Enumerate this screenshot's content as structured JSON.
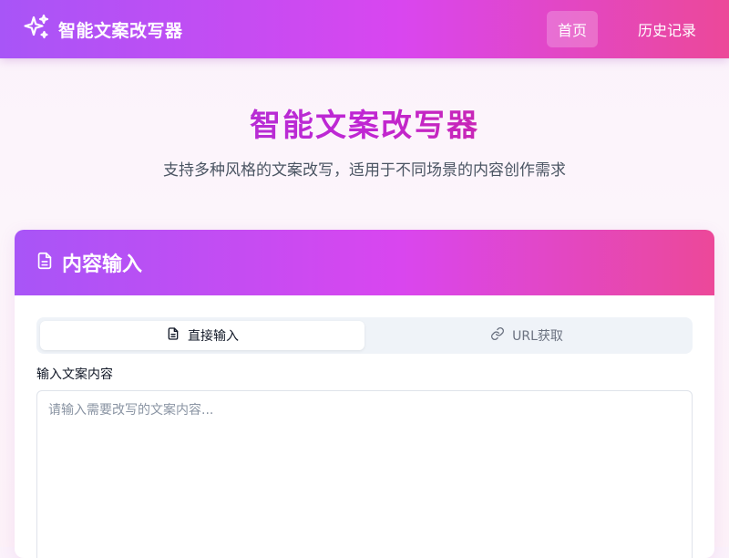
{
  "header": {
    "brand_name": "智能文案改写器",
    "brand_icon": "sparkles-icon",
    "nav": {
      "home_label": "首页",
      "history_label": "历史记录"
    }
  },
  "hero": {
    "title": "智能文案改写器",
    "subtitle": "支持多种风格的文案改写，适用于不同场景的内容创作需求"
  },
  "input_card": {
    "title": "内容输入",
    "title_icon": "document-icon",
    "tabs": [
      {
        "label": "直接输入",
        "icon": "document-icon",
        "active": true
      },
      {
        "label": "URL获取",
        "icon": "link-icon",
        "active": false
      }
    ],
    "field_label": "输入文案内容",
    "textarea": {
      "value": "",
      "placeholder": "请输入需要改写的文案内容..."
    }
  },
  "colors": {
    "gradient_start": "#a855f7",
    "gradient_mid": "#d946ef",
    "gradient_end": "#ec4899",
    "title_accent": "#c026d3"
  }
}
